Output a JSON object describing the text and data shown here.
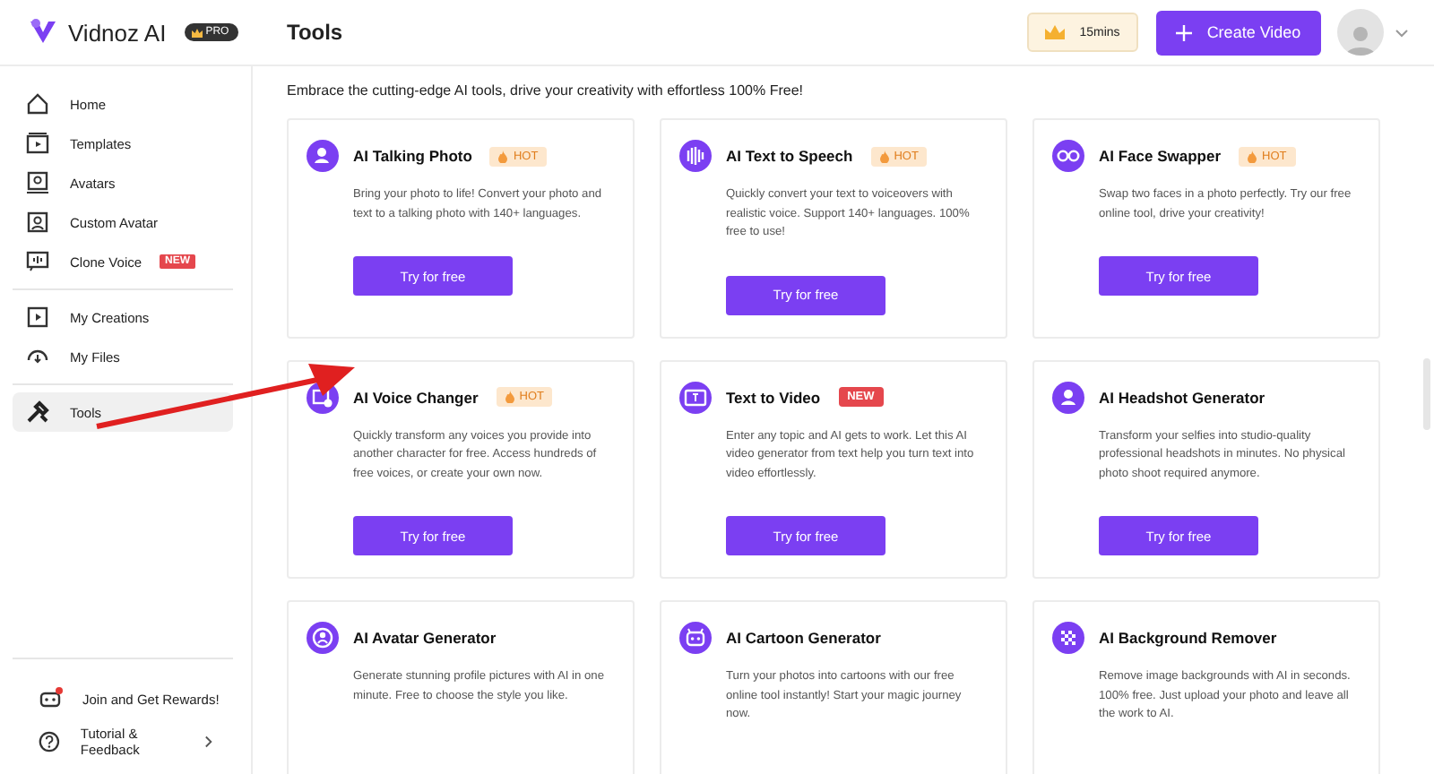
{
  "header": {
    "logo": "Vidnoz AI",
    "plan_badge": "PRO",
    "title": "Tools",
    "credits": "15mins",
    "create_button": "Create Video"
  },
  "sidebar": {
    "sections": [
      {
        "items": [
          {
            "label": "Home",
            "selected": false
          },
          {
            "label": "Templates",
            "selected": false
          },
          {
            "label": "Avatars",
            "selected": false
          },
          {
            "label": "Custom Avatar",
            "selected": false
          },
          {
            "label": "Clone Voice",
            "selected": false,
            "badge": "NEW"
          }
        ]
      },
      {
        "items": [
          {
            "label": "My Creations",
            "selected": false
          },
          {
            "label": "My Files",
            "selected": false
          }
        ]
      },
      {
        "items": [
          {
            "label": "Tools",
            "selected": true
          }
        ]
      }
    ],
    "bottom": [
      {
        "label": "Join and Get Rewards!"
      },
      {
        "label": "Tutorial & Feedback"
      }
    ]
  },
  "intro": "Embrace the cutting-edge AI tools, drive your creativity with effortless 100% Free!",
  "cards": [
    {
      "title": "AI Talking Photo",
      "badge": {
        "kind": "hot",
        "text": "HOT"
      },
      "description": "Bring your photo to life! Convert your photo and text to a talking photo with 140+ languages.",
      "button": "Try for free"
    },
    {
      "title": "AI Text to Speech",
      "badge": {
        "kind": "hot",
        "text": "HOT"
      },
      "description": "Quickly convert your text to voiceovers with realistic voice. Support 140+ languages. 100% free to use!",
      "button": "Try for free"
    },
    {
      "title": "AI Face Swapper",
      "badge": {
        "kind": "hot",
        "text": "HOT"
      },
      "description": "Swap two faces in a photo perfectly. Try our free online tool, drive your creativity!",
      "button": "Try for free"
    },
    {
      "title": "AI Voice Changer",
      "badge": {
        "kind": "hot",
        "text": "HOT"
      },
      "description": "Quickly transform any voices you provide into another character for free. Access hundreds of free voices, or create your own now.",
      "button": "Try for free"
    },
    {
      "title": "Text to Video",
      "badge": {
        "kind": "new",
        "text": "NEW"
      },
      "description": "Enter any topic and AI gets to work. Let this AI video generator from text help you turn text into video effortlessly.",
      "button": "Try for free"
    },
    {
      "title": "AI Headshot Generator",
      "description": "Transform your selfies into studio-quality professional headshots in minutes. No physical photo shoot required anymore.",
      "button": "Try for free"
    },
    {
      "title": "AI Avatar Generator",
      "description": "Generate stunning profile pictures with AI in one minute. Free to choose the style you like."
    },
    {
      "title": "AI Cartoon Generator",
      "description": "Turn your photos into cartoons with our free online tool instantly! Start your magic journey now."
    },
    {
      "title": "AI Background Remover",
      "description": "Remove image backgrounds with AI in seconds. 100% free. Just upload your photo and leave all the work to AI."
    }
  ]
}
